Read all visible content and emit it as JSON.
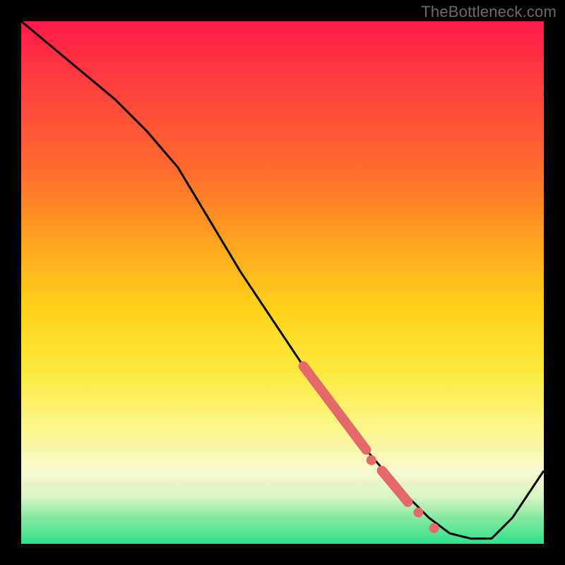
{
  "watermark": "TheBottleneck.com",
  "colors": {
    "line": "#000000",
    "marker": "#e46a6a",
    "frame": "#000000"
  },
  "chart_data": {
    "type": "line",
    "title": "",
    "xlabel": "",
    "ylabel": "",
    "xlim": [
      0,
      100
    ],
    "ylim": [
      0,
      100
    ],
    "grid": false,
    "legend": false,
    "series": [
      {
        "name": "bottleneck-curve",
        "x": [
          0,
          6,
          12,
          18,
          24,
          30,
          36,
          42,
          48,
          54,
          60,
          66,
          72,
          78,
          82,
          86,
          90,
          94,
          100
        ],
        "y": [
          100,
          95,
          90,
          85,
          79,
          72,
          62,
          52,
          43,
          34,
          26,
          18,
          11,
          5,
          2,
          1,
          1,
          5,
          14
        ]
      }
    ],
    "highlights": [
      {
        "name": "segment-upper",
        "type": "thick-segment",
        "x0": 54,
        "x1": 66,
        "y0": 34,
        "y1": 18
      },
      {
        "name": "dot-a",
        "type": "dot",
        "x": 67,
        "y": 16
      },
      {
        "name": "segment-lower",
        "type": "thick-segment",
        "x0": 69,
        "x1": 74,
        "y0": 14,
        "y1": 8
      },
      {
        "name": "dot-b",
        "type": "dot",
        "x": 76,
        "y": 6
      },
      {
        "name": "dot-c",
        "type": "dot",
        "x": 79,
        "y": 3
      }
    ]
  }
}
